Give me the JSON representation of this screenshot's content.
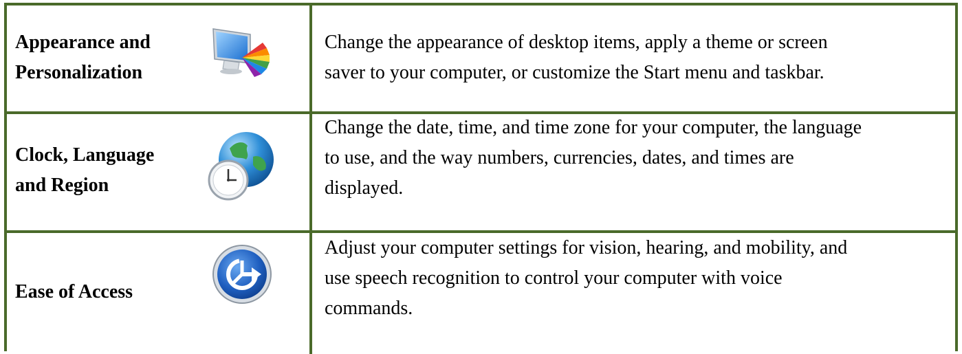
{
  "rows": [
    {
      "title_line1": "Appearance and",
      "title_line2": "Personalization",
      "icon": "appearance-personalization-icon",
      "description_lines": [
        "Change the appearance of desktop items, apply a theme or screen",
        "saver to your computer, or customize the Start menu and taskbar."
      ]
    },
    {
      "title_line1": "Clock, Language",
      "title_line2": "and Region",
      "icon": "globe-clock-icon",
      "description_lines": [
        "Change the date, time, and time zone for your computer, the language",
        "to use, and the way numbers, currencies, dates, and times are",
        "displayed."
      ]
    },
    {
      "title_line1": "Ease of Access",
      "icon": "ease-of-access-icon",
      "description_lines": [
        "Adjust your computer settings for vision, hearing, and mobility, and",
        "use speech recognition to control your computer with voice",
        "commands."
      ]
    }
  ],
  "colors": {
    "border": "#4a6a2a"
  }
}
